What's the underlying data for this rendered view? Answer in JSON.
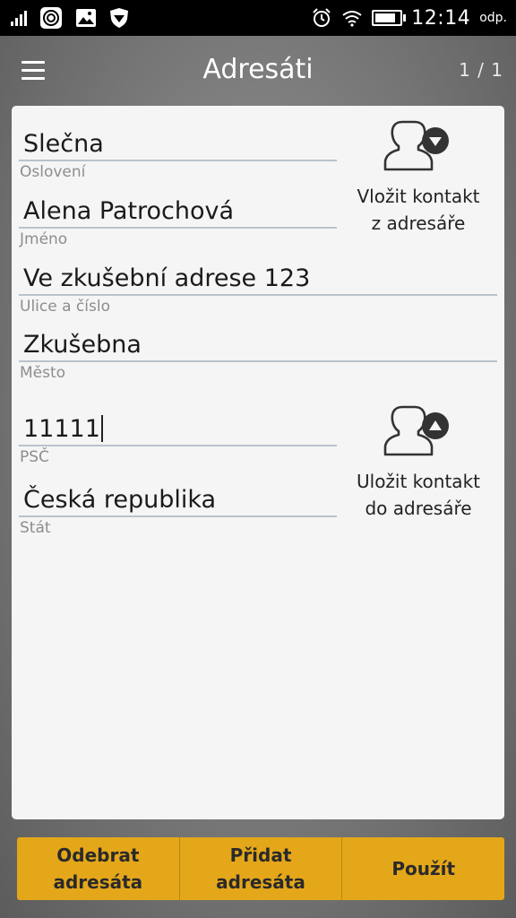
{
  "status_bar": {
    "time": "12:14",
    "odp": "odp.",
    "icons": [
      "signal-icon",
      "app-target-icon",
      "gallery-icon",
      "shield-icon",
      "alarm-icon",
      "wifi-icon",
      "battery-icon"
    ]
  },
  "app_bar": {
    "title": "Adresáti",
    "counter": "1 / 1"
  },
  "form": {
    "oslovení": {
      "value": "Slečna",
      "label": "Oslovení"
    },
    "jmeno": {
      "value": "Alena Patrochová",
      "label": "Jméno"
    },
    "ulice": {
      "value": "Ve zkušební adrese 123",
      "label": "Ulice a číslo"
    },
    "mesto": {
      "value": "Zkušebna",
      "label": "Město"
    },
    "psc": {
      "value": "11111",
      "label": "PSČ"
    },
    "stat": {
      "value": "Česká republika",
      "label": "Stát"
    }
  },
  "actions": {
    "insert_contact_line1": "Vložit kontakt",
    "insert_contact_line2": "z adresáře",
    "save_contact_line1": "Uložit kontakt",
    "save_contact_line2": "do adresáře"
  },
  "bottom": {
    "remove_line1": "Odebrat",
    "remove_line2": "adresáta",
    "add_line1": "Přidat",
    "add_line2": "adresáta",
    "apply": "Použít"
  },
  "colors": {
    "accent": "#e5a71a",
    "card": "#f5f5f5",
    "status_bar": "#000000"
  }
}
